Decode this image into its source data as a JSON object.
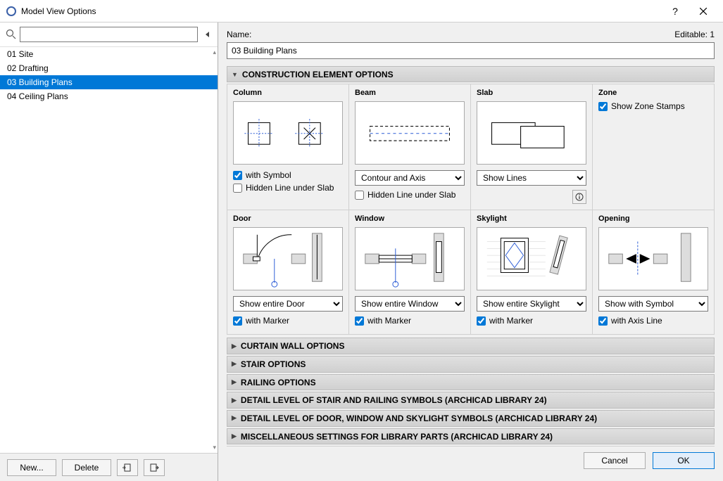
{
  "window": {
    "title": "Model View Options"
  },
  "sidebar": {
    "search": {
      "placeholder": ""
    },
    "items": [
      {
        "label": "01 Site"
      },
      {
        "label": "02 Drafting"
      },
      {
        "label": "03 Building Plans",
        "selected": true
      },
      {
        "label": "04 Ceiling Plans"
      }
    ],
    "buttons": {
      "new": "New...",
      "delete": "Delete"
    }
  },
  "main": {
    "name_label": "Name:",
    "editable_label": "Editable: 1",
    "name_value": "03 Building Plans",
    "sections": {
      "construction": "CONSTRUCTION ELEMENT OPTIONS",
      "curtain": "CURTAIN WALL OPTIONS",
      "stair": "STAIR OPTIONS",
      "railing": "RAILING OPTIONS",
      "detail_stair": "DETAIL LEVEL OF STAIR AND RAILING SYMBOLS (ARCHICAD LIBRARY 24)",
      "detail_door": "DETAIL LEVEL OF DOOR, WINDOW AND SKYLIGHT SYMBOLS (ARCHICAD LIBRARY 24)",
      "misc": "MISCELLANEOUS SETTINGS FOR LIBRARY PARTS (ARCHICAD LIBRARY 24)"
    },
    "options": {
      "column": {
        "title": "Column",
        "check1": "with Symbol",
        "check2": "Hidden Line under Slab"
      },
      "beam": {
        "title": "Beam",
        "select": "Contour and Axis",
        "check1": "Hidden Line under Slab"
      },
      "slab": {
        "title": "Slab",
        "select": "Show Lines"
      },
      "zone": {
        "title": "Zone",
        "check1": "Show Zone Stamps"
      },
      "door": {
        "title": "Door",
        "select": "Show entire Door",
        "check1": "with Marker"
      },
      "window": {
        "title": "Window",
        "select": "Show entire Window",
        "check1": "with Marker"
      },
      "skylight": {
        "title": "Skylight",
        "select": "Show entire Skylight",
        "check1": "with Marker"
      },
      "opening": {
        "title": "Opening",
        "select": "Show with Symbol",
        "check1": "with Axis Line"
      }
    },
    "footer": {
      "cancel": "Cancel",
      "ok": "OK"
    }
  }
}
